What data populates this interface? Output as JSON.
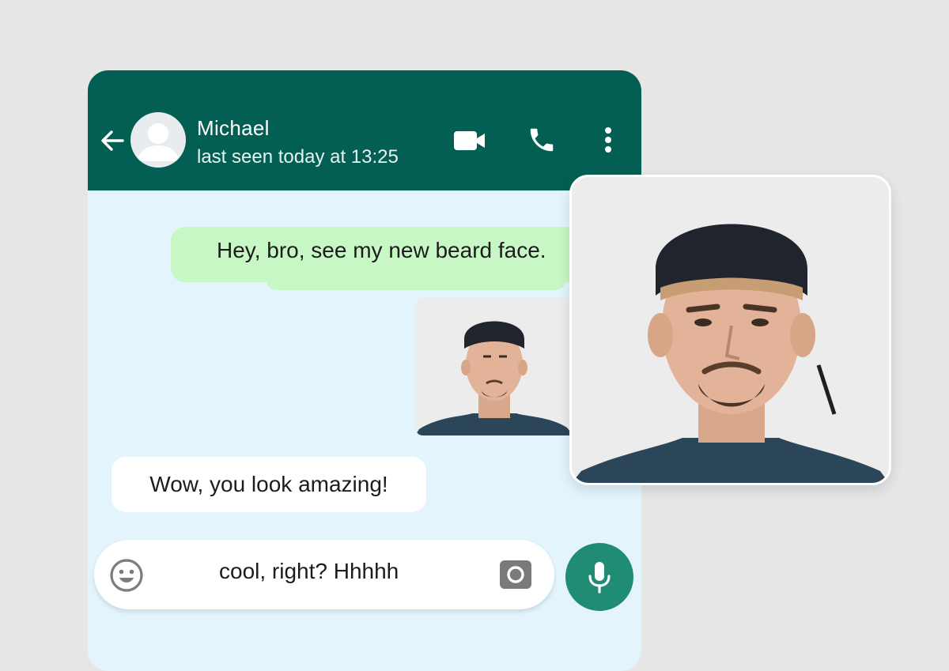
{
  "header": {
    "contact_name": "Michael",
    "status": "last seen today at 13:25",
    "icons": [
      "back-arrow-icon",
      "video-call-icon",
      "phone-call-icon",
      "more-options-icon"
    ]
  },
  "messages": [
    {
      "direction": "outgoing",
      "text": "Hey, bro, see my new beard face."
    },
    {
      "direction": "outgoing",
      "type": "photo",
      "icon": "photo-portrait-icon"
    },
    {
      "direction": "incoming",
      "text": "Wow, you look amazing!"
    }
  ],
  "composer": {
    "value": "cool, right? Hhhhh",
    "icons": [
      "emoji-icon",
      "camera-icon",
      "microphone-icon"
    ]
  },
  "colors": {
    "header": "#035f53",
    "chat_background": "#e3f4fd",
    "outgoing_bubble": "#c7f7c4",
    "incoming_bubble": "#ffffff",
    "mic_button": "#1f8c73",
    "page_background": "#e6e6e6"
  }
}
